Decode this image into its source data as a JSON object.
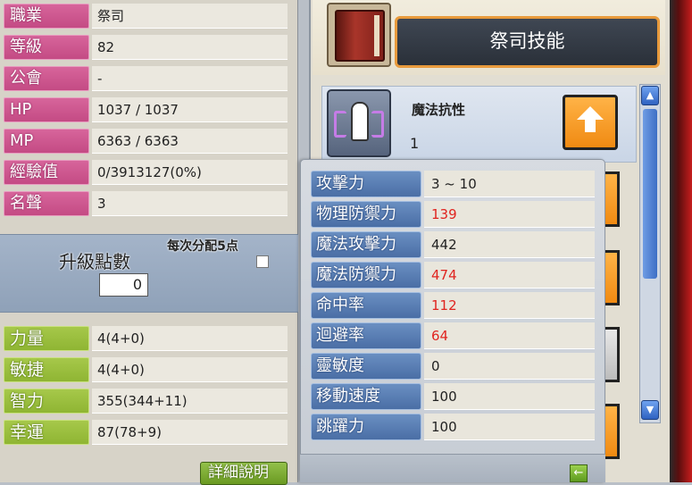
{
  "character": {
    "info": [
      {
        "label": "職業",
        "value": "祭司"
      },
      {
        "label": "等級",
        "value": "82"
      },
      {
        "label": "公會",
        "value": "-"
      },
      {
        "label": "HP",
        "value": "1037 / 1037"
      },
      {
        "label": "MP",
        "value": "6363 / 6363"
      },
      {
        "label": "經驗值",
        "value": "0/3913127(0%)"
      },
      {
        "label": "名聲",
        "value": "3"
      }
    ],
    "ability_points": {
      "label": "升級點數",
      "value": "0",
      "auto_assign_label": "每次分配5点"
    },
    "stats": [
      {
        "label": "力量",
        "value": "4(4+0)"
      },
      {
        "label": "敏捷",
        "value": "4(4+0)"
      },
      {
        "label": "智力",
        "value": "355(344+11)"
      },
      {
        "label": "幸運",
        "value": "87(78+9)"
      }
    ],
    "detail_button": "詳細說明"
  },
  "skill_window": {
    "title": "祭司技能",
    "skill": {
      "name": "魔法抗性",
      "level": "1",
      "icon": "magic-resistance-icon"
    },
    "scroll_up": "▲",
    "scroll_down": "▼"
  },
  "detail_stats": [
    {
      "label": "攻擊力",
      "value": "3 ~ 10",
      "highlight": false
    },
    {
      "label": "物理防禦力",
      "value": "139",
      "highlight": true
    },
    {
      "label": "魔法攻擊力",
      "value": "442",
      "highlight": false
    },
    {
      "label": "魔法防禦力",
      "value": "474",
      "highlight": true
    },
    {
      "label": "命中率",
      "value": "112",
      "highlight": true
    },
    {
      "label": "迴避率",
      "value": "64",
      "highlight": true
    },
    {
      "label": "靈敏度",
      "value": "0",
      "highlight": false
    },
    {
      "label": "移動速度",
      "value": "100",
      "highlight": false
    },
    {
      "label": "跳躍力",
      "value": "100",
      "highlight": false
    }
  ],
  "collapse_button": "←",
  "colors": {
    "highlight": "#e0241f",
    "info_label": "#c44b84",
    "stat_label": "#8fb533",
    "detail_label": "#4a6ea5"
  }
}
